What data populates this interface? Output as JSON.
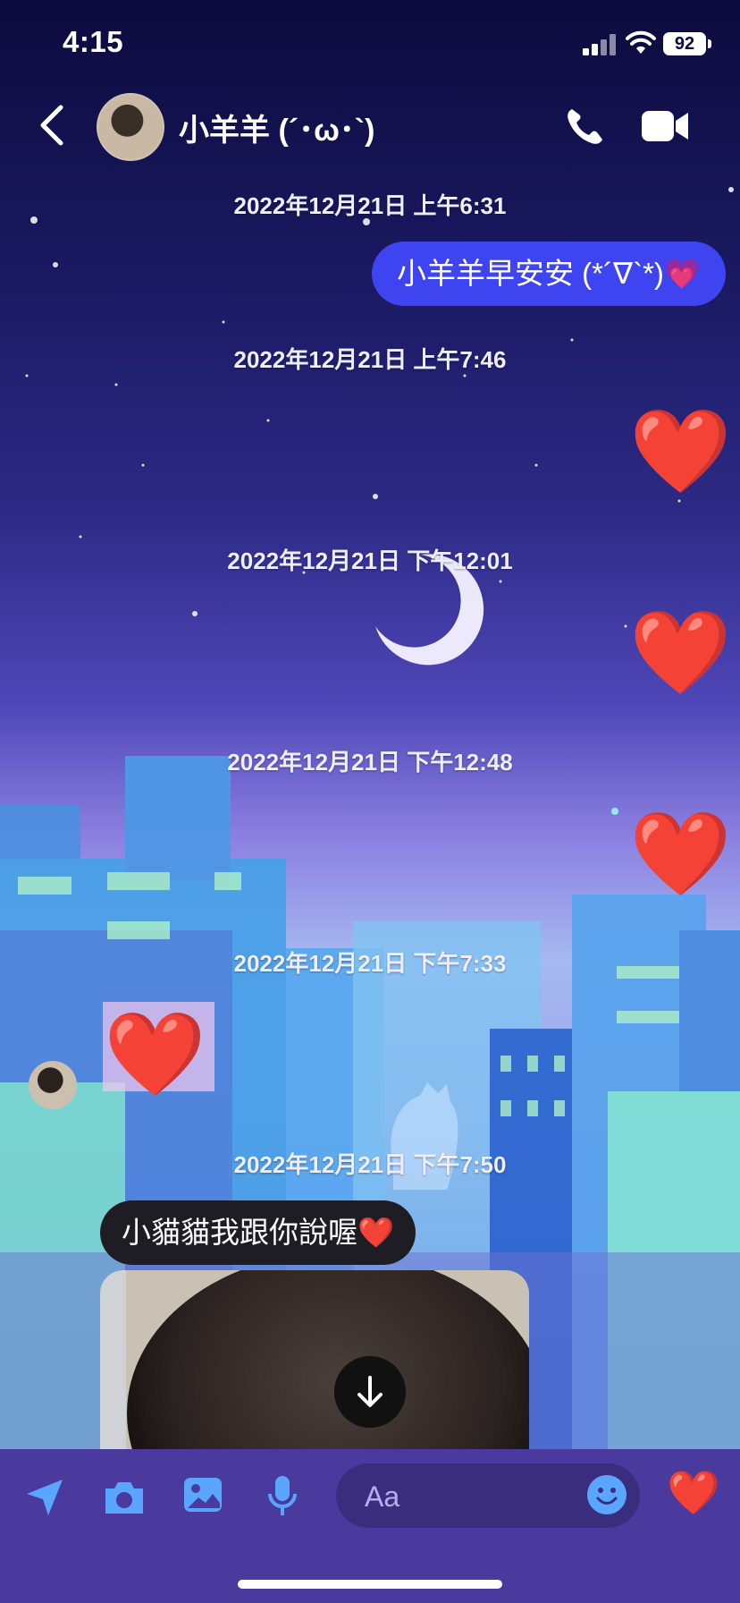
{
  "status_bar": {
    "time": "4:15",
    "battery": "92"
  },
  "header": {
    "contact_name": "小羊羊 (´･ω･`)"
  },
  "messages": {
    "ts1": "2022年12月21日 上午6:31",
    "out1": "小羊羊早安安 (*´∇`*)💗",
    "ts2": "2022年12月21日 上午7:46",
    "ts3": "2022年12月21日 下午12:01",
    "ts4": "2022年12月21日 下午12:48",
    "ts5": "2022年12月21日 下午7:33",
    "ts6": "2022年12月21日 下午7:50",
    "in1": "小貓貓我跟你說喔❤️",
    "heart": "❤️"
  },
  "composer": {
    "placeholder": "Aa",
    "like": "❤️"
  },
  "colors": {
    "bubble_out": "#3d44f0",
    "bubble_in": "#1f1d24",
    "composer_bg": "#4a3a9e"
  }
}
